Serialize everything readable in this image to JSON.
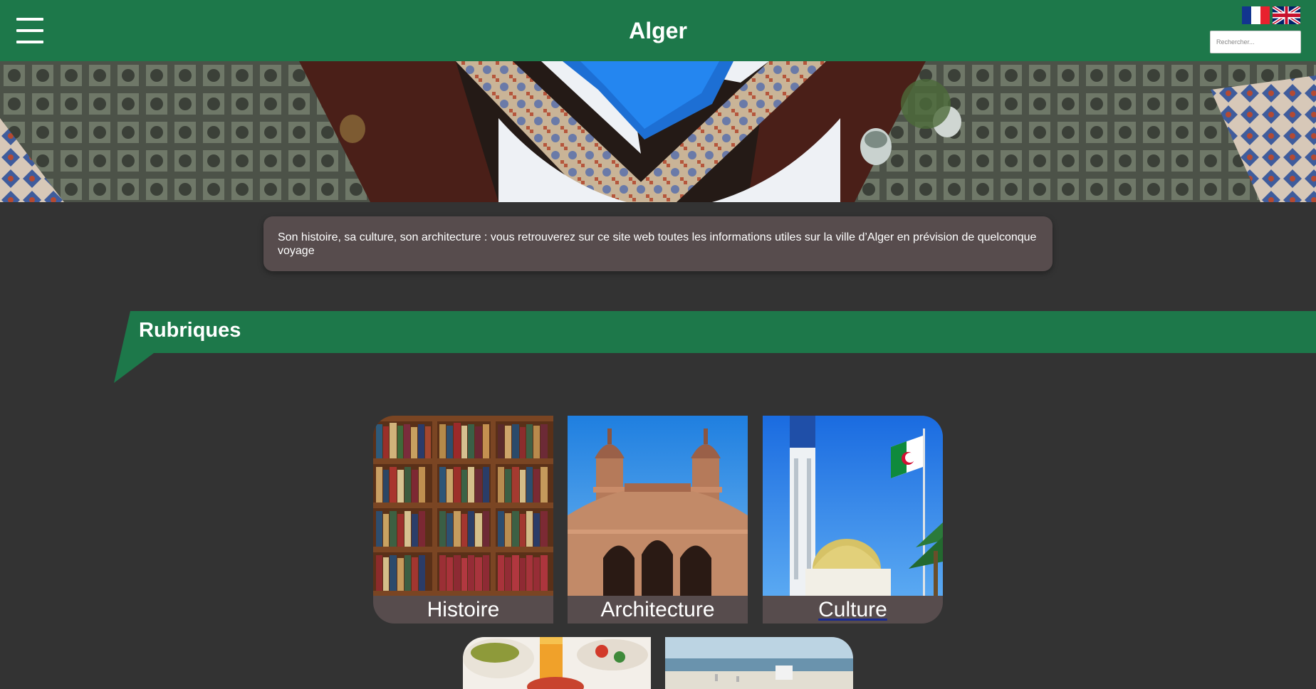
{
  "header": {
    "title": "Alger",
    "menu_icon": "hamburger-menu-icon",
    "languages": [
      {
        "code": "fr",
        "icon": "flag-france-icon"
      },
      {
        "code": "en",
        "icon": "flag-uk-icon"
      }
    ],
    "search_placeholder": "Rechercher..."
  },
  "intro": {
    "text": "Son histoire, sa culture, son architecture : vous retrouverez sur ce site web toutes les informations utiles sur la ville d’Alger en prévision de quelconque voyage"
  },
  "section": {
    "title": "Rubriques"
  },
  "cards": [
    {
      "label": "Histoire",
      "image": "bookshelf-photo"
    },
    {
      "label": "Architecture",
      "image": "ketchaoua-mosque-photo"
    },
    {
      "label": "Culture",
      "image": "great-mosque-minaret-flag-photo"
    },
    {
      "label": "",
      "image": "algerian-food-photo"
    },
    {
      "label": "",
      "image": "beach-coast-photo"
    }
  ],
  "colors": {
    "brand_green": "#1d784a",
    "background": "#333333",
    "card_bg": "#574c4d",
    "text": "#ffffff"
  }
}
